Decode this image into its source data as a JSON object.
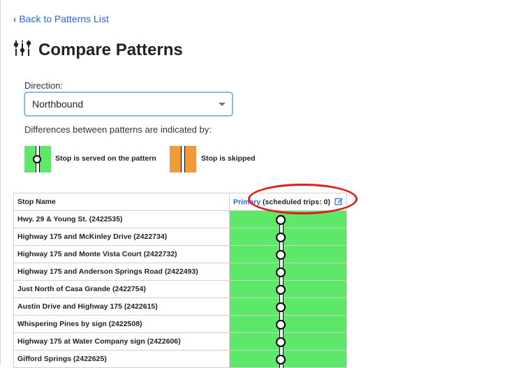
{
  "nav": {
    "back_label": "Back to Patterns List"
  },
  "page": {
    "title": "Compare Patterns"
  },
  "direction": {
    "label": "Direction:",
    "selected": "Northbound"
  },
  "legend": {
    "intro": "Differences between patterns are indicated by:",
    "served_label": "Stop is served on the pattern",
    "skipped_label": "Stop is skipped",
    "served_color": "#5ee86a",
    "skipped_color": "#f2993a"
  },
  "table": {
    "stop_header": "Stop Name",
    "pattern": {
      "name": "Primary",
      "trips_text": "(scheduled trips: 0)"
    },
    "rows": [
      "Hwy. 29 & Young St. (2422535)",
      "Highway 175 and McKinley Drive (2422734)",
      "Highway 175 and Monte Vista Court (2422732)",
      "Highway 175 and Anderson Springs Road (2422493)",
      "Just North of Casa Grande (2422754)",
      "Austin Drive and Highway 175 (2422615)",
      "Whispering Pines by sign (2422508)",
      "Highway 175 at Water Company sign (2422606)",
      "Gifford Springs (2422625)"
    ]
  },
  "annotation": {
    "color": "#e31b1b"
  }
}
